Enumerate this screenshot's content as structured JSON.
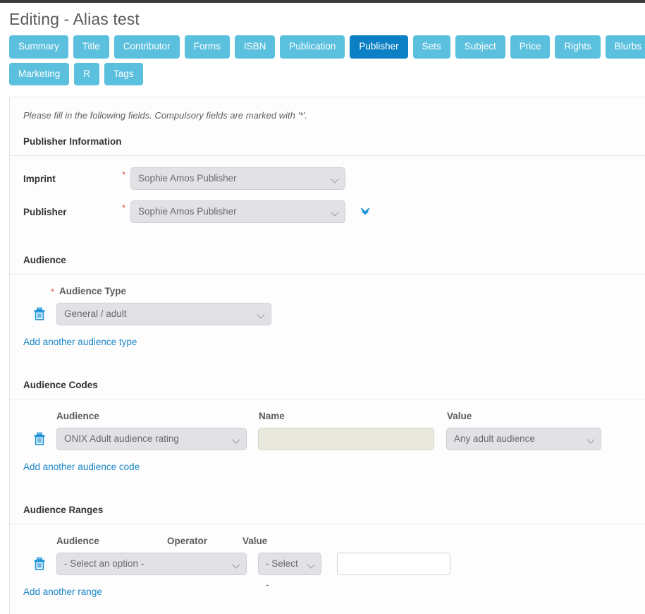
{
  "page": {
    "title": "Editing - Alias test",
    "intro": "Please fill in the following fields. Compulsory fields are marked with '*'."
  },
  "tabs": [
    {
      "label": "Summary",
      "active": false
    },
    {
      "label": "Title",
      "active": false
    },
    {
      "label": "Contributor",
      "active": false
    },
    {
      "label": "Forms",
      "active": false
    },
    {
      "label": "ISBN",
      "active": false
    },
    {
      "label": "Publication",
      "active": false
    },
    {
      "label": "Publisher",
      "active": true
    },
    {
      "label": "Sets",
      "active": false
    },
    {
      "label": "Subject",
      "active": false
    },
    {
      "label": "Price",
      "active": false
    },
    {
      "label": "Rights",
      "active": false
    },
    {
      "label": "Blurbs",
      "active": false
    },
    {
      "label": "Marketing",
      "active": false
    },
    {
      "label": "R",
      "active": false
    },
    {
      "label": "Tags",
      "active": false
    }
  ],
  "publisher_information": {
    "heading": "Publisher Information",
    "imprint": {
      "label": "Imprint",
      "required_marker": "*",
      "value": "Sophie Amos Publisher"
    },
    "publisher": {
      "label": "Publisher",
      "required_marker": "*",
      "value": "Sophie Amos Publisher"
    }
  },
  "audience": {
    "heading": "Audience",
    "type_label": "Audience Type",
    "required_marker": "*",
    "value": "General / adult",
    "add_link": "Add another audience type"
  },
  "audience_codes": {
    "heading": "Audience Codes",
    "columns": {
      "audience": "Audience",
      "name": "Name",
      "value": "Value"
    },
    "row": {
      "audience": "ONIX Adult audience rating",
      "name": "",
      "value": "Any adult audience"
    },
    "add_link": "Add another audience code"
  },
  "audience_ranges": {
    "heading": "Audience Ranges",
    "columns": {
      "audience": "Audience",
      "operator": "Operator",
      "value": "Value"
    },
    "row": {
      "audience": "- Select an option -",
      "operator": "- Select -",
      "value": ""
    },
    "add_link": "Add another range"
  },
  "colors": {
    "tab": "#5bc0de",
    "tab_active": "#0c80c4",
    "link": "#1a86c8",
    "required": "#d9534f",
    "icon_blue": "#2196d8"
  }
}
